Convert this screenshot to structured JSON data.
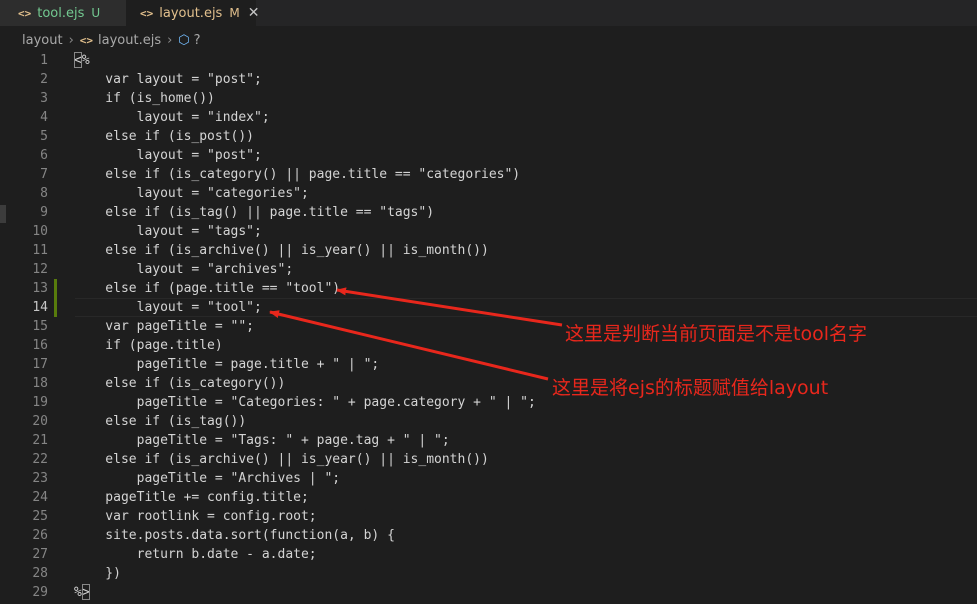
{
  "tabs": [
    {
      "icon": "<>",
      "name": "tool.ejs",
      "status": "U"
    },
    {
      "icon": "<>",
      "name": "layout.ejs",
      "status": "M",
      "close": "✕"
    }
  ],
  "breadcrumb": {
    "folder": "layout",
    "file_icon": "<>",
    "file": "layout.ejs",
    "symbol": "?"
  },
  "code_lines": [
    {
      "num": "1",
      "text": "<%"
    },
    {
      "num": "2",
      "text": "    var layout = \"post\";"
    },
    {
      "num": "3",
      "text": "    if (is_home())"
    },
    {
      "num": "4",
      "text": "        layout = \"index\";"
    },
    {
      "num": "5",
      "text": "    else if (is_post())"
    },
    {
      "num": "6",
      "text": "        layout = \"post\";"
    },
    {
      "num": "7",
      "text": "    else if (is_category() || page.title == \"categories\")"
    },
    {
      "num": "8",
      "text": "        layout = \"categories\";"
    },
    {
      "num": "9",
      "text": "    else if (is_tag() || page.title == \"tags\")"
    },
    {
      "num": "10",
      "text": "        layout = \"tags\";"
    },
    {
      "num": "11",
      "text": "    else if (is_archive() || is_year() || is_month())"
    },
    {
      "num": "12",
      "text": "        layout = \"archives\";"
    },
    {
      "num": "13",
      "text": "    else if (page.title == \"tool\")"
    },
    {
      "num": "14",
      "text": "        layout = \"tool\";"
    },
    {
      "num": "15",
      "text": "    var pageTitle = \"\";"
    },
    {
      "num": "16",
      "text": "    if (page.title)"
    },
    {
      "num": "17",
      "text": "        pageTitle = page.title + \" | \";"
    },
    {
      "num": "18",
      "text": "    else if (is_category())"
    },
    {
      "num": "19",
      "text": "        pageTitle = \"Categories: \" + page.category + \" | \";"
    },
    {
      "num": "20",
      "text": "    else if (is_tag())"
    },
    {
      "num": "21",
      "text": "        pageTitle = \"Tags: \" + page.tag + \" | \";"
    },
    {
      "num": "22",
      "text": "    else if (is_archive() || is_year() || is_month())"
    },
    {
      "num": "23",
      "text": "        pageTitle = \"Archives | \";"
    },
    {
      "num": "24",
      "text": "    pageTitle += config.title;"
    },
    {
      "num": "25",
      "text": "    var rootlink = config.root;"
    },
    {
      "num": "26",
      "text": "    site.posts.data.sort(function(a, b) {"
    },
    {
      "num": "27",
      "text": "        return b.date - a.date;"
    },
    {
      "num": "28",
      "text": "    })"
    },
    {
      "num": "29",
      "text": "%>"
    }
  ],
  "active_line": 14,
  "annotations": [
    {
      "text": "这里是判断当前页面是不是tool名字"
    },
    {
      "text": "这里是将ejs的标题赋值给layout"
    }
  ],
  "colors": {
    "annotation": "#e8271c",
    "untracked": "#73c991",
    "modified": "#e2c08d"
  }
}
